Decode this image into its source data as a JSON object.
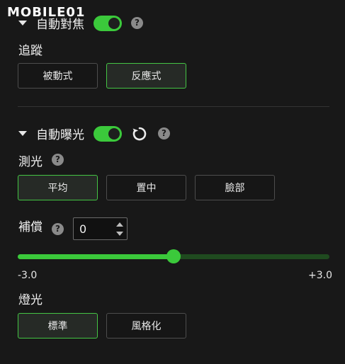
{
  "watermark": "MOBILE01",
  "autofocus": {
    "title": "自動對焦",
    "enabled": true,
    "help": "?",
    "tracking_label": "追蹤",
    "tracking_options": [
      "被動式",
      "反應式"
    ],
    "tracking_selected": 1
  },
  "autoexposure": {
    "title": "自動曝光",
    "enabled": true,
    "help": "?",
    "metering_label": "測光",
    "metering_help": "?",
    "metering_options": [
      "平均",
      "置中",
      "臉部"
    ],
    "metering_selected": 0,
    "compensation_label": "補償",
    "compensation_help": "?",
    "compensation_value": "0",
    "slider_min": "-3.0",
    "slider_max": "+3.0",
    "slider_level": 0.5,
    "lighting_label": "燈光",
    "lighting_options": [
      "標準",
      "風格化"
    ],
    "lighting_selected": 0
  },
  "colors": {
    "accent": "#3bc93b",
    "track": "#1f4a1f",
    "background": "#181818"
  },
  "icons": [
    "caret-down-icon",
    "reset-icon",
    "help-icon"
  ]
}
